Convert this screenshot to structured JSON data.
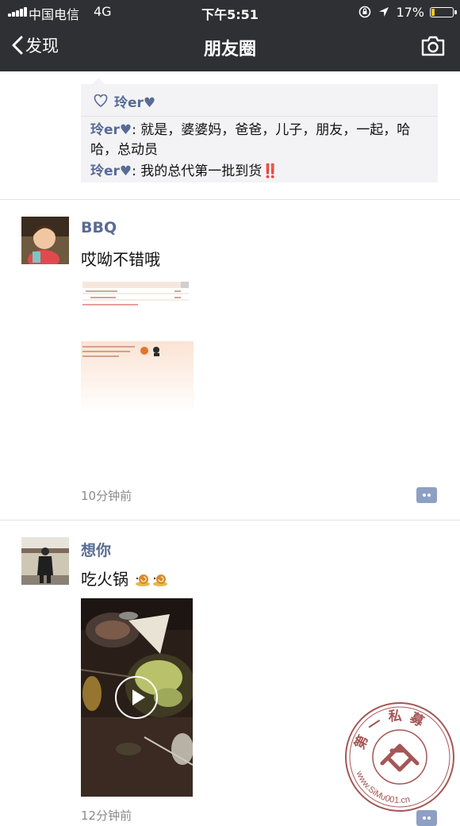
{
  "status_bar": {
    "carrier": "中国电信",
    "network": "4G",
    "time": "下午5:51",
    "battery_label": "17%",
    "battery_level": 0.17,
    "battery_color": "#f5c518"
  },
  "nav": {
    "back_label": "发现",
    "title": "朋友圈",
    "camera_icon": "camera-icon"
  },
  "prev_post": {
    "likes": "玲er♥",
    "comments": [
      {
        "name": "玲er♥",
        "text": "就是，婆婆妈，爸爸，儿子，朋友，一起，哈哈，总动员"
      },
      {
        "name": "玲er♥",
        "text": "我的总代第一批到货‼️"
      }
    ]
  },
  "posts": [
    {
      "author": "BBQ",
      "text": "哎呦不错哦",
      "time": "10分钟前"
    },
    {
      "author": "想你",
      "text": "吃火锅",
      "time": "12分钟前"
    }
  ],
  "watermark": {
    "top_text": "第一私募",
    "url_text": "www.SiMu001.cn"
  },
  "colors": {
    "name_blue": "#576b95",
    "nav_bg": "#2f3033"
  }
}
